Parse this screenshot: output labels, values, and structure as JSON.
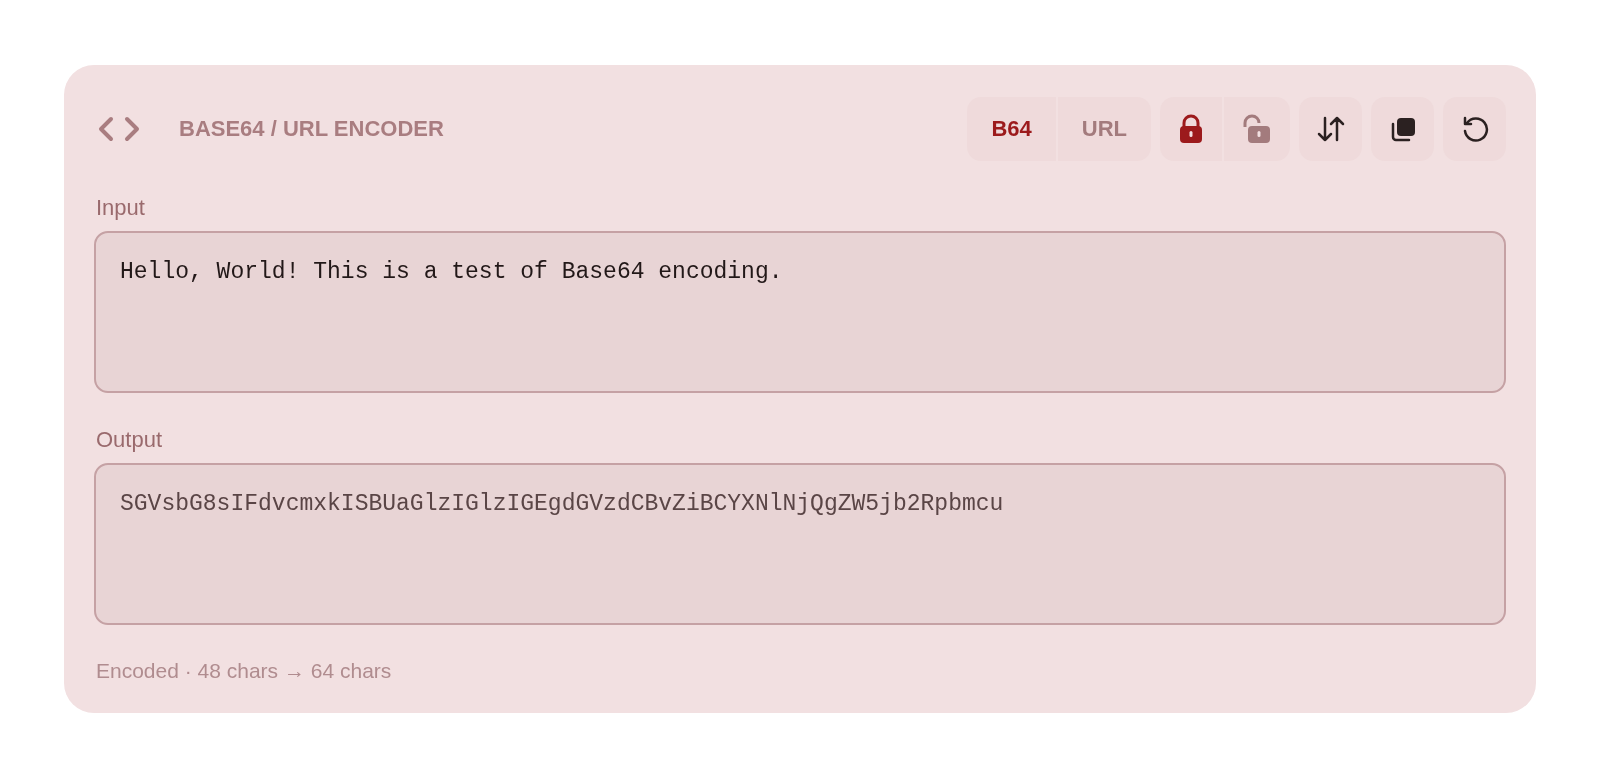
{
  "header": {
    "title": "BASE64 / URL ENCODER"
  },
  "modes": [
    {
      "label": "B64",
      "selected": true
    },
    {
      "label": "URL",
      "selected": false
    }
  ],
  "locks": [
    {
      "kind": "locked",
      "selected": true
    },
    {
      "kind": "unlocked",
      "selected": false
    }
  ],
  "actions": [
    {
      "kind": "swap"
    },
    {
      "kind": "copy"
    },
    {
      "kind": "reset"
    }
  ],
  "input": {
    "label": "Input",
    "value": "Hello, World! This is a test of Base64 encoding."
  },
  "output": {
    "label": "Output",
    "value": "SGVsbG8sIFdvcmxkISBUaGlzIGlzIGEgdGVzdCBvZiBCYXNlNjQgZW5jb2Rpbmcu"
  },
  "status": "Encoded · 48 chars → 64 chars"
}
